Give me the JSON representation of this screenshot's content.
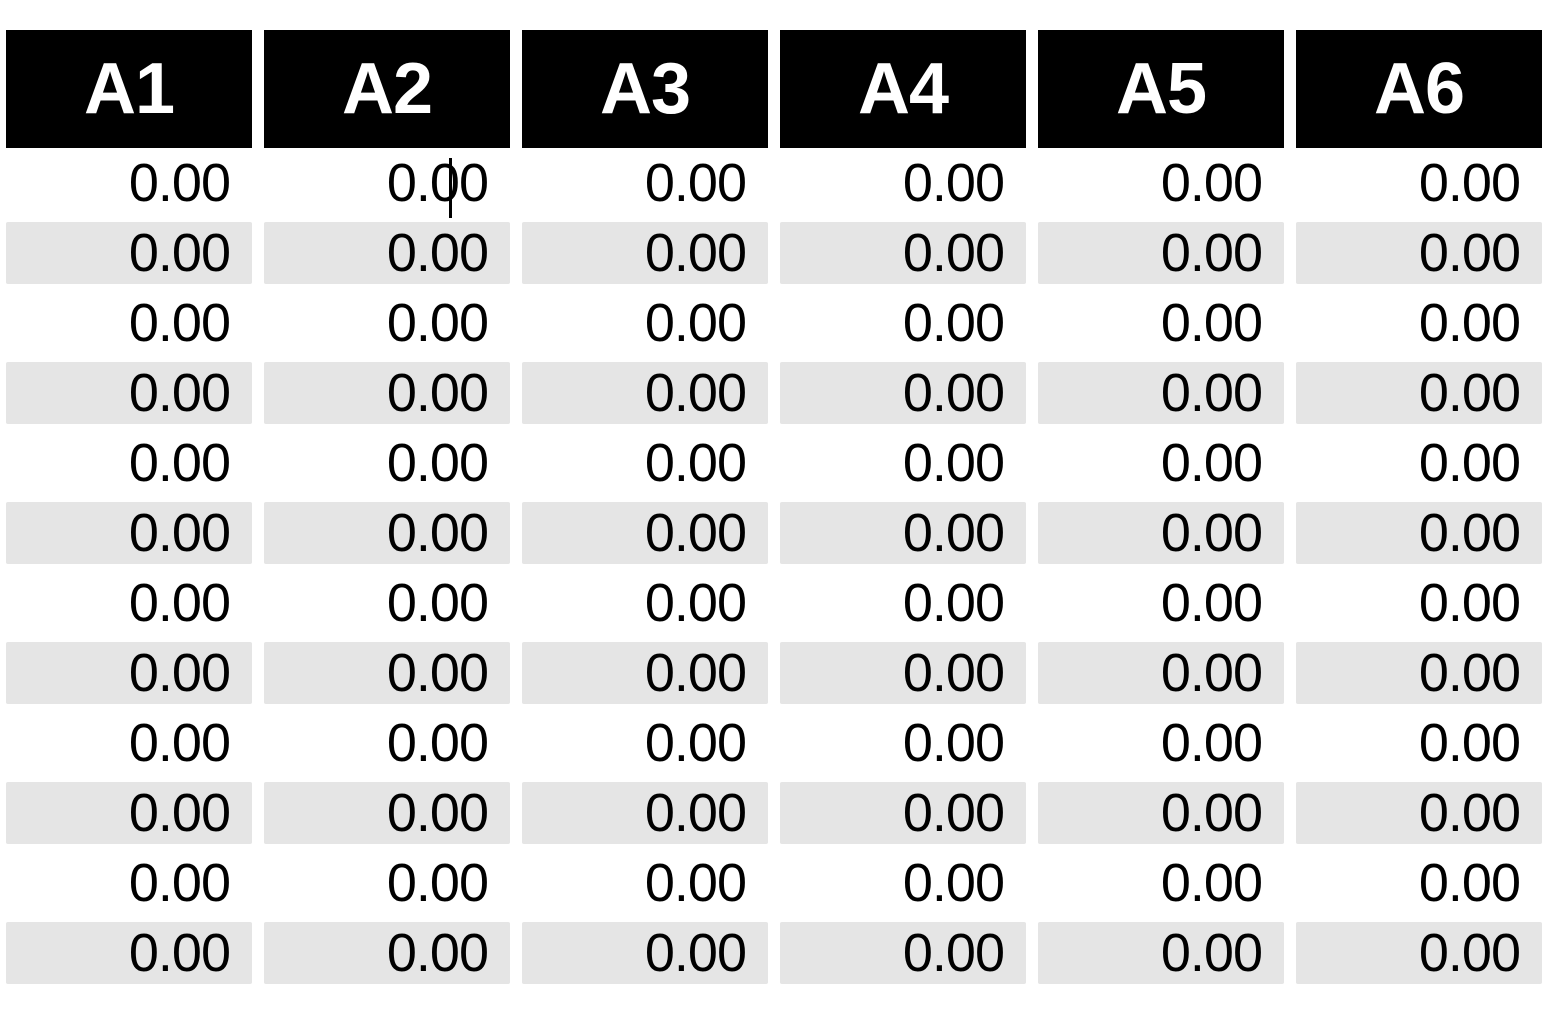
{
  "spreadsheet": {
    "headers": [
      "A1",
      "A2",
      "A3",
      "A4",
      "A5",
      "A6"
    ],
    "rows": [
      [
        "0.00",
        "0.00",
        "0.00",
        "0.00",
        "0.00",
        "0.00"
      ],
      [
        "0.00",
        "0.00",
        "0.00",
        "0.00",
        "0.00",
        "0.00"
      ],
      [
        "0.00",
        "0.00",
        "0.00",
        "0.00",
        "0.00",
        "0.00"
      ],
      [
        "0.00",
        "0.00",
        "0.00",
        "0.00",
        "0.00",
        "0.00"
      ],
      [
        "0.00",
        "0.00",
        "0.00",
        "0.00",
        "0.00",
        "0.00"
      ],
      [
        "0.00",
        "0.00",
        "0.00",
        "0.00",
        "0.00",
        "0.00"
      ],
      [
        "0.00",
        "0.00",
        "0.00",
        "0.00",
        "0.00",
        "0.00"
      ],
      [
        "0.00",
        "0.00",
        "0.00",
        "0.00",
        "0.00",
        "0.00"
      ],
      [
        "0.00",
        "0.00",
        "0.00",
        "0.00",
        "0.00",
        "0.00"
      ],
      [
        "0.00",
        "0.00",
        "0.00",
        "0.00",
        "0.00",
        "0.00"
      ],
      [
        "0.00",
        "0.00",
        "0.00",
        "0.00",
        "0.00",
        "0.00"
      ],
      [
        "0.00",
        "0.00",
        "0.00",
        "0.00",
        "0.00",
        "0.00"
      ]
    ],
    "active_cell": {
      "row": 0,
      "col": 1
    }
  }
}
